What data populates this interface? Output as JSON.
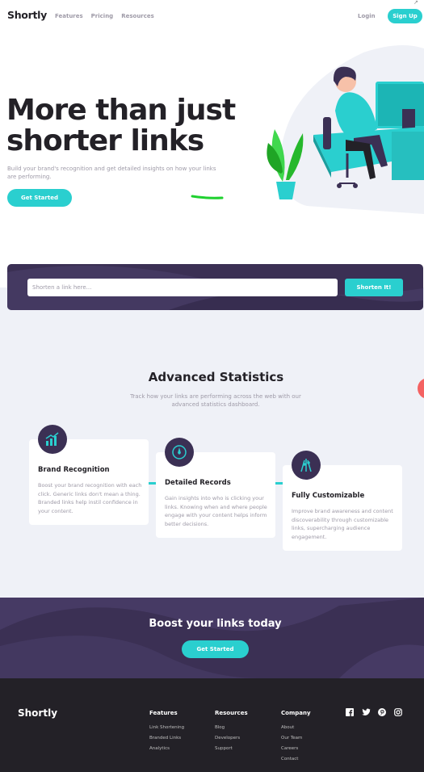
{
  "header": {
    "logo": "Shortly",
    "nav": [
      "Features",
      "Pricing",
      "Resources"
    ],
    "login": "Login",
    "signup": "Sign Up"
  },
  "hero": {
    "title": "More than just shorter links",
    "subtitle": "Build your brand's recognition and get detailed insights on how your links are performing.",
    "cta": "Get Started"
  },
  "shorten": {
    "placeholder": "Shorten a link here...",
    "button": "Shorten It!"
  },
  "stats": {
    "title": "Advanced Statistics",
    "subtitle": "Track how your links are performing across the web with our advanced statistics dashboard.",
    "cards": [
      {
        "icon": "brand-recognition-icon",
        "title": "Brand Recognition",
        "text": "Boost your brand recognition with each click. Generic links don't mean a thing. Branded links help instil confidence in your content."
      },
      {
        "icon": "detailed-records-icon",
        "title": "Detailed Records",
        "text": "Gain insights into who is clicking your links. Knowing when and where people engage with your content helps inform better decisions."
      },
      {
        "icon": "fully-customizable-icon",
        "title": "Fully Customizable",
        "text": "Improve brand awareness and content discoverability through customizable links, supercharging audience engagement."
      }
    ]
  },
  "boost": {
    "title": "Boost your links today",
    "cta": "Get Started"
  },
  "footer": {
    "logo": "Shortly",
    "columns": [
      {
        "heading": "Features",
        "links": [
          "Link Shortening",
          "Branded Links",
          "Analytics"
        ]
      },
      {
        "heading": "Resources",
        "links": [
          "Blog",
          "Developers",
          "Support"
        ]
      },
      {
        "heading": "Company",
        "links": [
          "About",
          "Our Team",
          "Careers",
          "Contact"
        ]
      }
    ],
    "social": [
      "facebook-icon",
      "twitter-icon",
      "pinterest-icon",
      "instagram-icon"
    ]
  },
  "colors": {
    "cyan": "#2acfcf",
    "dark_violet": "#3b3054",
    "red": "#f46262",
    "gray": "#9e9aa7",
    "very_dark": "#232127",
    "light_bg": "#eff1f7"
  }
}
